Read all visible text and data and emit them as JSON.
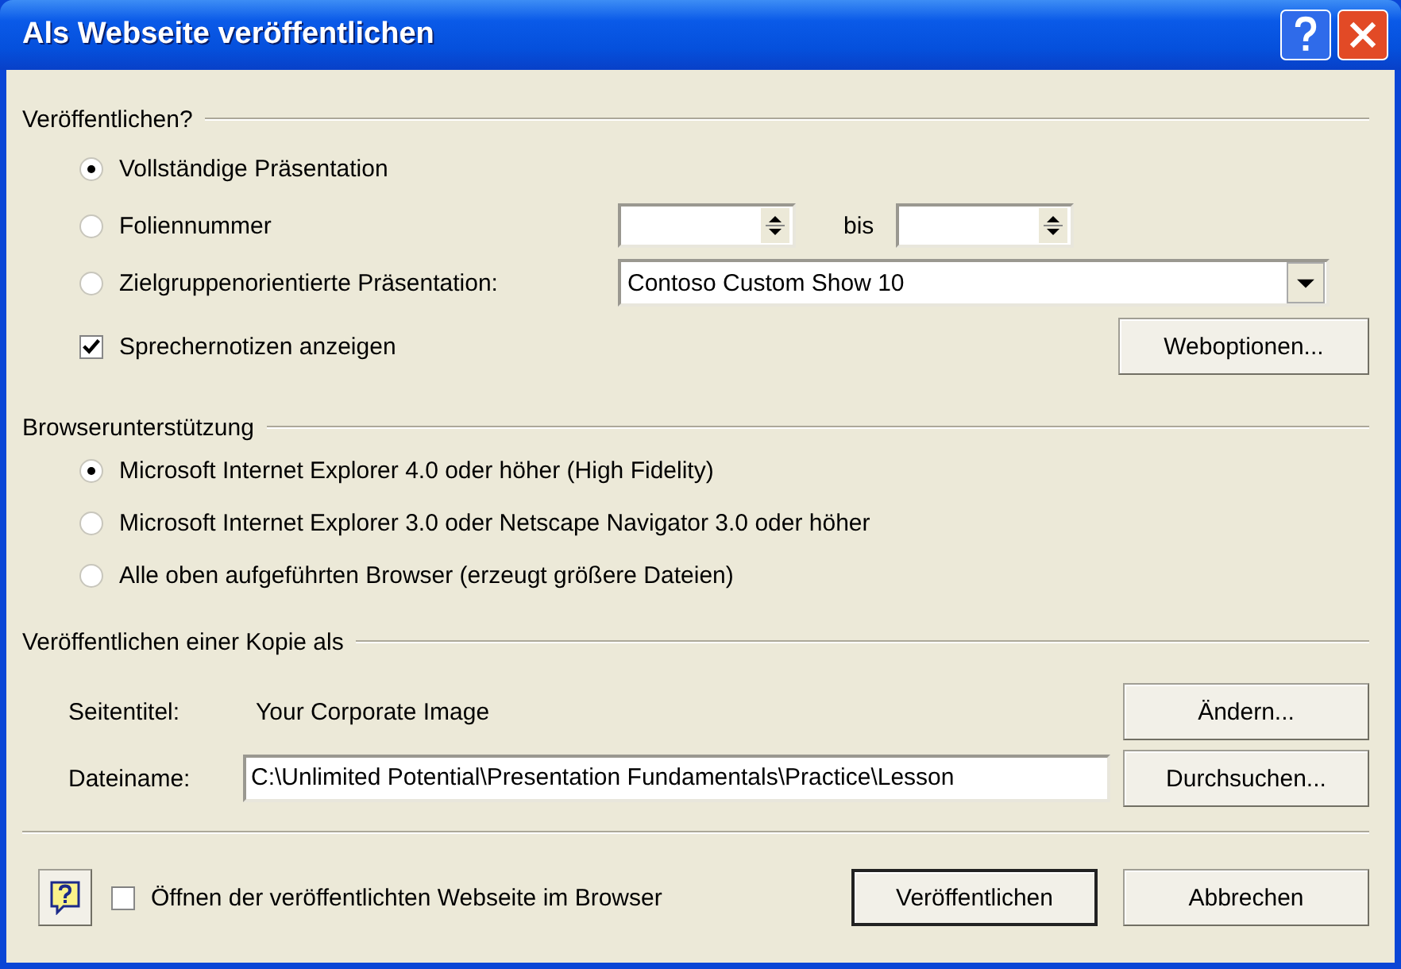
{
  "window": {
    "title": "Als Webseite veröffentlichen"
  },
  "publish": {
    "title": "Veröffentlichen?",
    "options": [
      {
        "kind": "plain",
        "label": "Vollständige Präsentation",
        "selected": true
      },
      {
        "kind": "range",
        "label": "Foliennummer",
        "selected": false,
        "between": "bis"
      },
      {
        "kind": "show",
        "label": "Zielgruppenorientierte Präsentation:",
        "selected": false,
        "value": "Contoso Custom Show 10"
      }
    ],
    "notes": {
      "label": "Sprechernotizen anzeigen",
      "checked": true
    },
    "button": "Weboptionen..."
  },
  "browser": {
    "title": "Browserunterstützung",
    "options": [
      {
        "label": "Microsoft Internet Explorer 4.0 oder höher (High Fidelity)",
        "selected": true
      },
      {
        "label": "Microsoft Internet Explorer 3.0 oder Netscape Navigator 3.0 oder höher",
        "selected": false
      },
      {
        "label": "Alle oben aufgeführten Browser (erzeugt größere Dateien)",
        "selected": false
      }
    ]
  },
  "copy": {
    "title": "Veröffentlichen einer Kopie als",
    "page_title": {
      "label": "Seitentitel:",
      "value": "Your Corporate Image",
      "button": "Ändern..."
    },
    "file_name": {
      "label": "Dateiname:",
      "value": "C:\\Unlimited Potential\\Presentation Fundamentals\\Practice\\Lesson",
      "button": "Durchsuchen..."
    }
  },
  "footer": {
    "open_in_browser": {
      "label": "Öffnen der veröffentlichten Webseite im Browser",
      "checked": false
    },
    "buttons": [
      {
        "label": "Veröffentlichen",
        "default": true
      },
      {
        "label": "Abbrechen",
        "default": false
      }
    ]
  }
}
